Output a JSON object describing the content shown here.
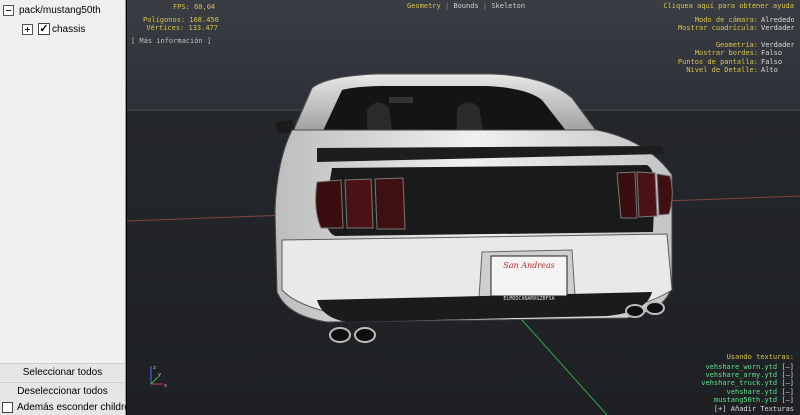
{
  "tree": {
    "root_label": "pack/mustang50th",
    "child_label": "chassis",
    "child_checked": true
  },
  "panel": {
    "select_all": "Seleccionar todos",
    "deselect_all": "Deseleccionar todos",
    "hide_children": "Además esconder children",
    "hide_children_checked": false
  },
  "viewport": {
    "tabs": {
      "geometry": "Geometry",
      "bounds": "Bounds",
      "skeleton": "Skeleton",
      "separator": "|"
    },
    "fps": "FPS: 60,04",
    "polygons": "Polígonos: 168.450",
    "vertices": "Vértices: 133.477",
    "more_info": "[ Más información ]",
    "help": "Cliquea aquí para obtener ayuda",
    "settings": {
      "camera_mode_label": "Modo de cámara:",
      "camera_mode_value": "Alrededor",
      "grid_label": "Mostrar cuadrícula:",
      "grid_value": "Verdadero",
      "geometry_label": "Geometría:",
      "geometry_value": "Verdadero",
      "edges_label": "Mostrar bordes:",
      "edges_value": "Falso",
      "screen_points_label": "Puntos de pantalla:",
      "screen_points_value": "Falso",
      "lod_label": "Nivel de Detalle:",
      "lod_value": "Alto"
    },
    "textures": {
      "title": "Usando texturas:",
      "remove": "[–]",
      "items": [
        "vehshare_worn.ytd",
        "vehshare_army.ytd",
        "vehshare_truck.ytd",
        "vehshare.ytd",
        "mustang50th.ytd"
      ],
      "add": "[+] Añadir Texturas"
    },
    "plate": {
      "brand": "San Andreas",
      "bottom_text": "ELMODCANAMXGZBFSA"
    },
    "axis": {
      "x": "x",
      "y": "y",
      "z": "z"
    }
  }
}
